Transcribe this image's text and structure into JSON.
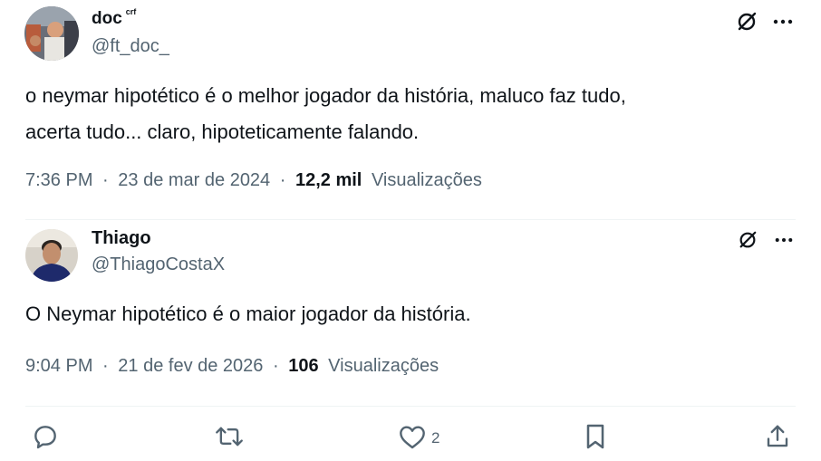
{
  "tweet1": {
    "name": "doc",
    "name_super": "crf",
    "handle": "@ft_doc_",
    "text_line1": "o neymar hipotético é o melhor jogador da história, maluco faz tudo,",
    "text_line2": "acerta tudo... claro, hipoteticamente falando.",
    "time": "7:36 PM",
    "date": "23 de mar de 2024",
    "views_count": "12,2 mil",
    "views_label": "Visualizações"
  },
  "tweet2": {
    "name": "Thiago",
    "handle": "@ThiagoCostaX",
    "text": "O Neymar hipotético é o maior jogador da história.",
    "time": "9:04 PM",
    "date": "21 de fev de 2026",
    "views_count": "106",
    "views_label": "Visualizações"
  },
  "actions": {
    "like_count": "2"
  },
  "meta_separator": "·",
  "colors": {
    "primary_text": "#0f1419",
    "secondary_text": "#536471",
    "divider": "#eff3f4"
  },
  "icons": [
    "grok-icon",
    "more-icon",
    "reply-icon",
    "retweet-icon",
    "like-icon",
    "bookmark-icon",
    "share-icon"
  ]
}
